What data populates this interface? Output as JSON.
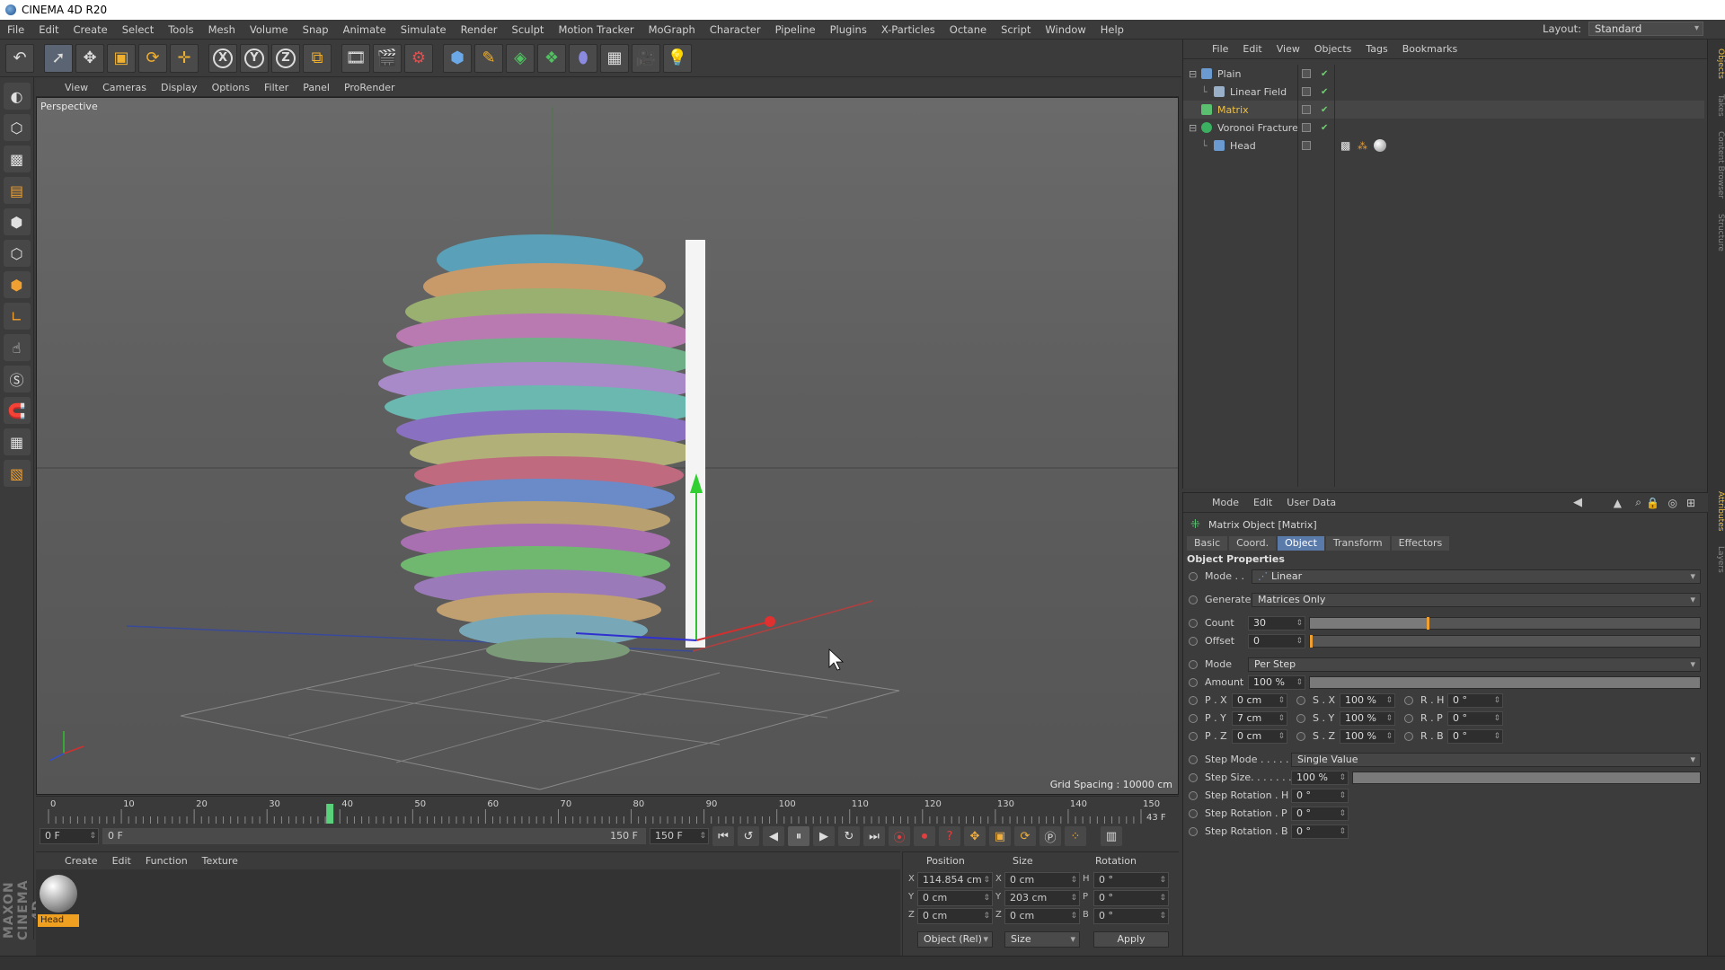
{
  "app": {
    "title": "CINEMA 4D R20"
  },
  "menubar": {
    "items": [
      "File",
      "Edit",
      "Create",
      "Select",
      "Tools",
      "Mesh",
      "Volume",
      "Snap",
      "Animate",
      "Simulate",
      "Render",
      "Sculpt",
      "Motion Tracker",
      "MoGraph",
      "Character",
      "Pipeline",
      "Plugins",
      "X-Particles",
      "Octane",
      "Script",
      "Window",
      "Help"
    ],
    "layout_label": "Layout:",
    "layout_value": "Standard"
  },
  "toolbar": {
    "icons": [
      "undo-icon",
      "live-selection-icon",
      "move-icon",
      "scale-icon",
      "rotate-icon",
      "recent-tool-icon",
      "x-axis-icon",
      "y-axis-icon",
      "z-axis-icon",
      "coordinate-system-icon",
      "render-view-icon",
      "render-picture-viewer-icon",
      "edit-render-settings-icon",
      "cube-icon",
      "pen-icon",
      "subdivision-icon",
      "array-icon",
      "deformer-icon",
      "floor-icon",
      "camera-icon",
      "light-icon"
    ],
    "axis_x": "X",
    "axis_y": "Y",
    "axis_z": "Z"
  },
  "lefttools": {
    "icons": [
      "make-editable-icon",
      "model-mode-icon",
      "texture-mode-icon",
      "workplane-icon",
      "points-mode-icon",
      "edges-mode-icon",
      "polygons-mode-icon",
      "axis-mode-icon",
      "tweak-icon",
      "solo-icon",
      "snap-icon",
      "workplane-lock-icon",
      "planar-workplane-icon"
    ]
  },
  "viewport": {
    "menu": [
      "View",
      "Cameras",
      "Display",
      "Options",
      "Filter",
      "Panel",
      "ProRender"
    ],
    "label": "Perspective",
    "grid_spacing": "Grid Spacing : 10000 cm"
  },
  "timeline": {
    "ticks": [
      "0",
      "10",
      "20",
      "30",
      "40",
      "50",
      "60",
      "70",
      "80",
      "90",
      "100",
      "110",
      "120",
      "130",
      "140",
      "150"
    ],
    "current_frame_fraction": 0.2575,
    "frame_display": "43 F",
    "start_field": "0 F",
    "range_start": "0 F",
    "range_end": "150 F",
    "end_field": "150 F"
  },
  "material_manager": {
    "menu": [
      "Create",
      "Edit",
      "Function",
      "Texture"
    ],
    "material_name": "Head"
  },
  "coordinates": {
    "headers": {
      "position": "Position",
      "size": "Size",
      "rotation": "Rotation"
    },
    "rows": [
      {
        "axis": "X",
        "pos": "114.854 cm",
        "size_axis": "X",
        "size": "0 cm",
        "rot_axis": "H",
        "rot": "0 °"
      },
      {
        "axis": "Y",
        "pos": "0 cm",
        "size_axis": "Y",
        "size": "203 cm",
        "rot_axis": "P",
        "rot": "0 °"
      },
      {
        "axis": "Z",
        "pos": "0 cm",
        "size_axis": "Z",
        "size": "0 cm",
        "rot_axis": "B",
        "rot": "0 °"
      }
    ],
    "mode_dropdown": "Object (Rel)",
    "size_dropdown": "Size",
    "apply_label": "Apply"
  },
  "object_manager": {
    "menu": [
      "File",
      "Edit",
      "View",
      "Objects",
      "Tags",
      "Bookmarks"
    ],
    "objects": [
      {
        "name": "Plain",
        "indent": 0,
        "expander": "⊟",
        "icon_color": "#6a9ad0",
        "highlight": false
      },
      {
        "name": "Linear Field",
        "indent": 1,
        "expander": "",
        "icon_color": "#9ab0c8",
        "highlight": false
      },
      {
        "name": "Matrix",
        "indent": 0,
        "expander": "",
        "icon_color": "#5ac070",
        "highlight": true
      },
      {
        "name": "Voronoi Fracture",
        "indent": 0,
        "expander": "⊟",
        "icon_color": "#3ab060",
        "highlight": false
      },
      {
        "name": "Head",
        "indent": 1,
        "expander": "",
        "icon_color": "#6a9ad0",
        "highlight": false
      }
    ]
  },
  "right_tabs": [
    "Objects",
    "Takes",
    "Content Browser",
    "Structure",
    "Attributes",
    "Layers"
  ],
  "attribute_manager": {
    "menu": [
      "Mode",
      "Edit",
      "User Data"
    ],
    "title": "Matrix Object [Matrix]",
    "tabs": [
      "Basic",
      "Coord.",
      "Object",
      "Transform",
      "Effectors"
    ],
    "active_tab": "Object",
    "section": "Object Properties",
    "mode_label": "Mode . .",
    "mode_value": "Linear",
    "generate_label": "Generate",
    "generate_value": "Matrices Only",
    "count_label": "Count",
    "count_value": "30",
    "count_fraction": 0.3,
    "offset_label": "Offset",
    "offset_value": "0",
    "mode2_label": "Mode",
    "mode2_value": "Per Step",
    "amount_label": "Amount",
    "amount_value": "100 %",
    "px_label": "P . X",
    "px_value": "0 cm",
    "py_label": "P . Y",
    "py_value": "7 cm",
    "pz_label": "P . Z",
    "pz_value": "0 cm",
    "sx_label": "S . X",
    "sx_value": "100 %",
    "sy_label": "S . Y",
    "sy_value": "100 %",
    "sz_label": "S . Z",
    "sz_value": "100 %",
    "rh_label": "R . H",
    "rh_value": "0 °",
    "rp_label": "R . P",
    "rp_value": "0 °",
    "rb_label": "R . B",
    "rb_value": "0 °",
    "stepmode_label": "Step Mode . . . . .",
    "stepmode_value": "Single Value",
    "stepsize_label": "Step Size. . . . . . .",
    "stepsize_value": "100 %",
    "steprot_h_label": "Step Rotation . H",
    "steprot_h_value": "0 °",
    "steprot_p_label": "Step Rotation . P",
    "steprot_p_value": "0 °",
    "steprot_b_label": "Step Rotation . B",
    "steprot_b_value": "0 °"
  }
}
